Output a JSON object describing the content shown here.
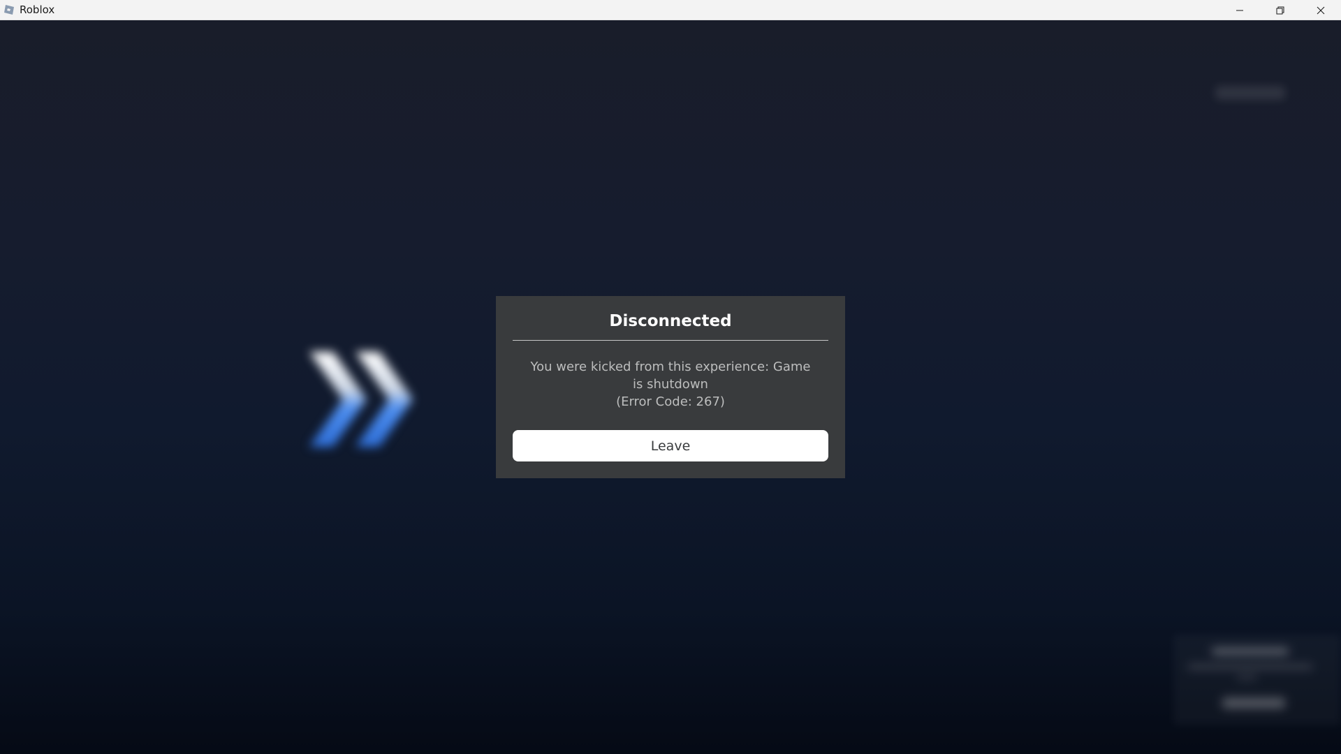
{
  "window": {
    "title": "Roblox",
    "icon": "roblox-app-icon",
    "controls": [
      "minimize-icon",
      "restore-icon",
      "close-icon"
    ]
  },
  "background": {
    "decoration_icon": "double-chevron-icon",
    "accent_color": "#3f7fe6"
  },
  "dialog": {
    "title": "Disconnected",
    "message": "You were kicked from this experience: Game is shutdown",
    "error": "(Error Code: 267)",
    "leave_label": "Leave"
  },
  "colors": {
    "dialog_bg": "#393b3d",
    "button_bg": "#ffffff",
    "title_bar_bg": "#f3f3f3"
  }
}
